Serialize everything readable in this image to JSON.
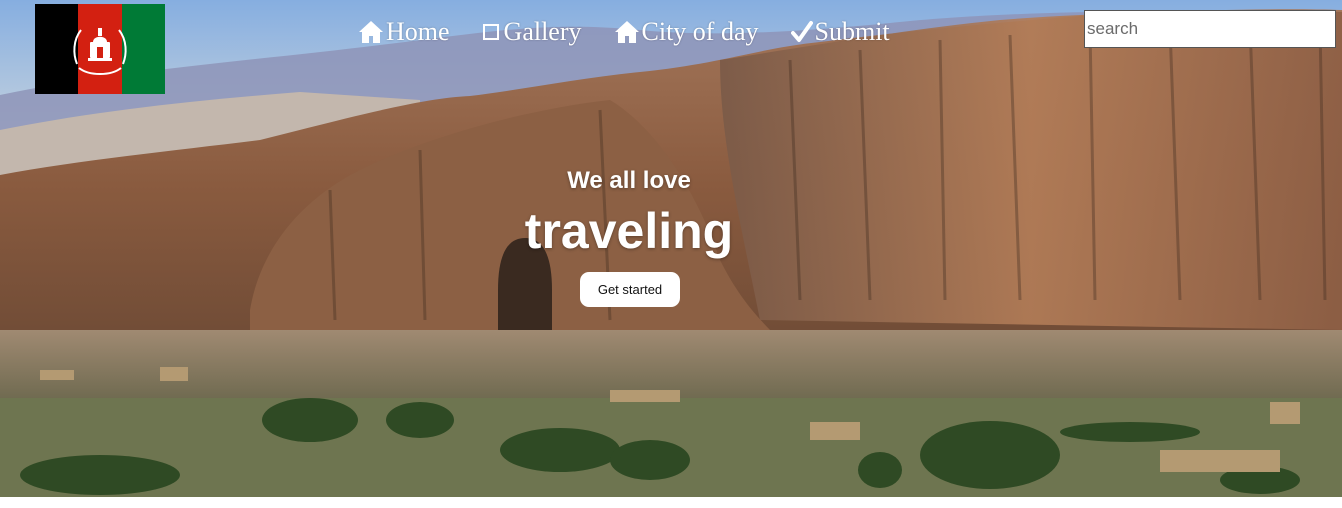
{
  "nav": {
    "items": [
      {
        "label": "Home",
        "icon": "home-icon"
      },
      {
        "label": "Gallery",
        "icon": "square-outline-icon"
      },
      {
        "label": "City of day",
        "icon": "home-icon"
      },
      {
        "label": "Submit",
        "icon": "checkmark-icon"
      }
    ]
  },
  "search": {
    "placeholder": "search"
  },
  "hero": {
    "subheading": "We all love",
    "heading": "traveling",
    "cta_label": "Get started"
  },
  "flag": {
    "colors": [
      "#000000",
      "#d32011",
      "#007a36"
    ],
    "emblem_color": "#ffffff"
  }
}
